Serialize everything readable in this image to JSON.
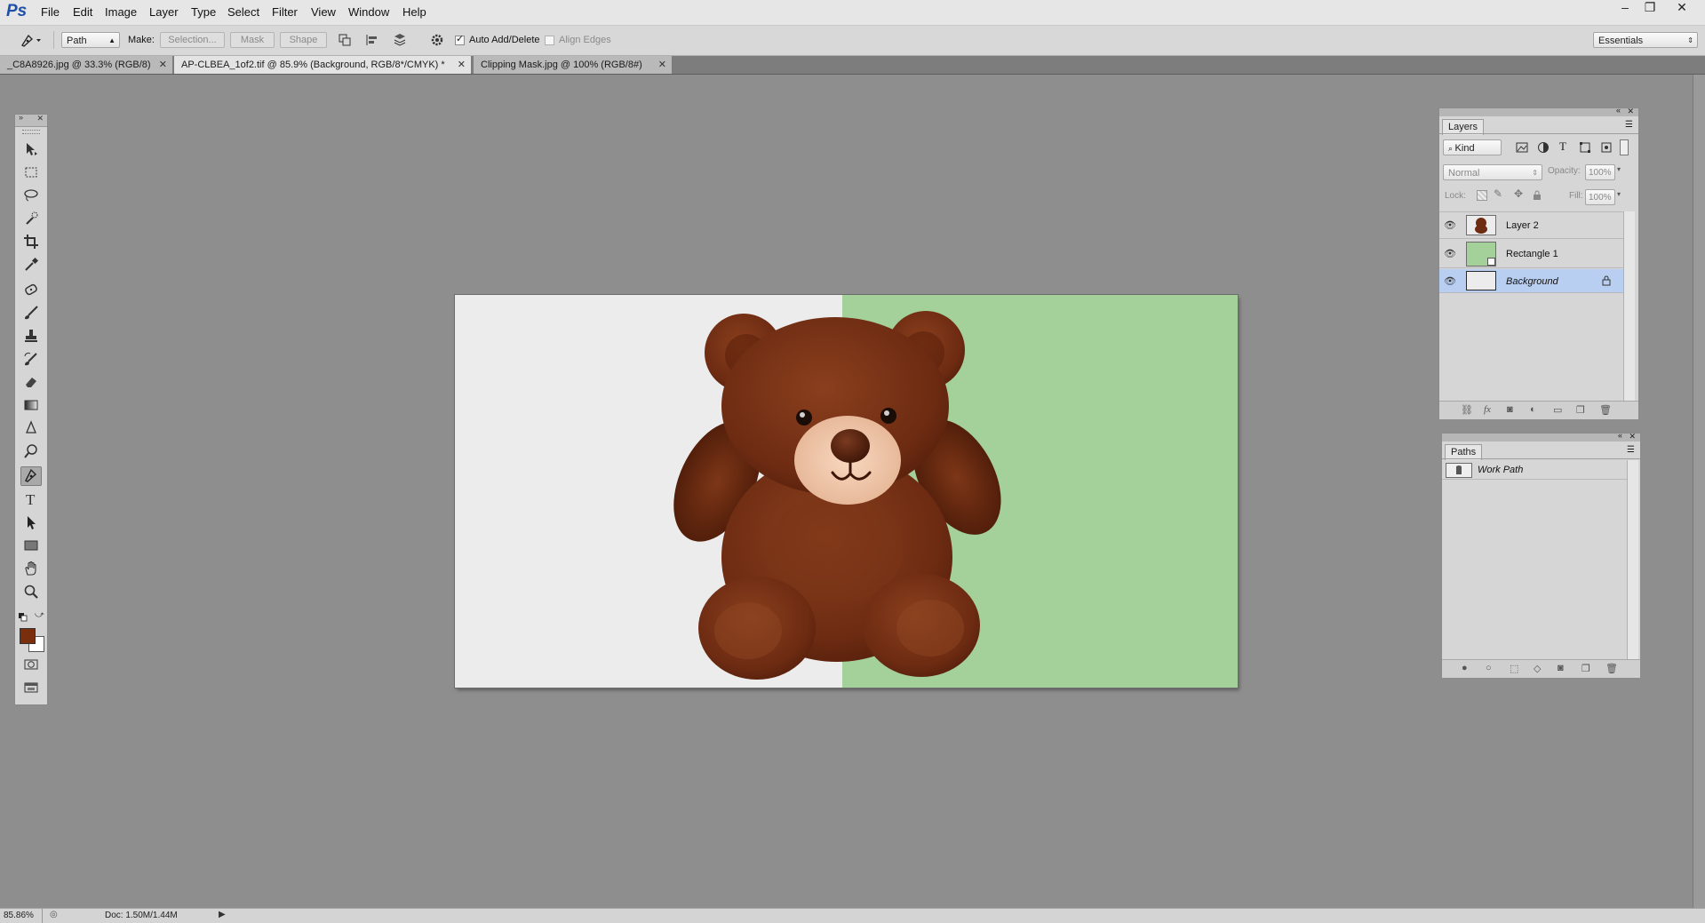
{
  "app": {
    "logo": "Ps"
  },
  "menu": [
    "File",
    "Edit",
    "Image",
    "Layer",
    "Type",
    "Select",
    "Filter",
    "View",
    "Window",
    "Help"
  ],
  "window_controls": {
    "minimize": "–",
    "restore": "❐",
    "close": "✕"
  },
  "options_bar": {
    "mode": "Path",
    "make_label": "Make:",
    "selection_btn": "Selection...",
    "mask_btn": "Mask",
    "shape_btn": "Shape",
    "auto_add_delete": "Auto Add/Delete",
    "auto_add_delete_checked": true,
    "align_edges": "Align Edges",
    "align_edges_checked": false,
    "workspace": "Essentials"
  },
  "doc_tabs": [
    {
      "label": "_C8A8926.jpg @ 33.3% (RGB/8)",
      "active": false
    },
    {
      "label": "AP-CLBEA_1of2.tif @ 85.9% (Background, RGB/8*/CMYK) *",
      "active": true
    },
    {
      "label": "Clipping Mask.jpg @ 100% (RGB/8#)",
      "active": false
    }
  ],
  "tools": [
    "move-tool",
    "marquee-tool",
    "lasso-tool",
    "quick-selection-tool",
    "crop-tool",
    "eyedropper-tool",
    "spot-healing-tool",
    "brush-tool",
    "clone-stamp-tool",
    "history-brush-tool",
    "eraser-tool",
    "gradient-tool",
    "blur-tool",
    "dodge-tool",
    "pen-tool",
    "type-tool",
    "path-selection-tool",
    "rectangle-tool",
    "hand-tool",
    "zoom-tool"
  ],
  "colors": {
    "foreground": "#7a2e0c",
    "background": "#ffffff",
    "canvas_left": "#ececec",
    "canvas_right": "#a4d09a",
    "selection": "#b9cff2"
  },
  "layers_panel": {
    "title": "Layers",
    "kind_filter": "Kind",
    "blend_mode": "Normal",
    "opacity_label": "Opacity:",
    "opacity": "100%",
    "lock_label": "Lock:",
    "fill_label": "Fill:",
    "fill": "100%",
    "layers": [
      {
        "name": "Layer 2",
        "selected": false,
        "locked": false,
        "italic": false
      },
      {
        "name": "Rectangle 1",
        "selected": false,
        "locked": false,
        "italic": false
      },
      {
        "name": "Background",
        "selected": true,
        "locked": true,
        "italic": true
      }
    ]
  },
  "paths_panel": {
    "title": "Paths",
    "paths": [
      {
        "name": "Work Path"
      }
    ]
  },
  "status_bar": {
    "zoom": "85.86%",
    "doc_info": "Doc: 1.50M/1.44M"
  }
}
